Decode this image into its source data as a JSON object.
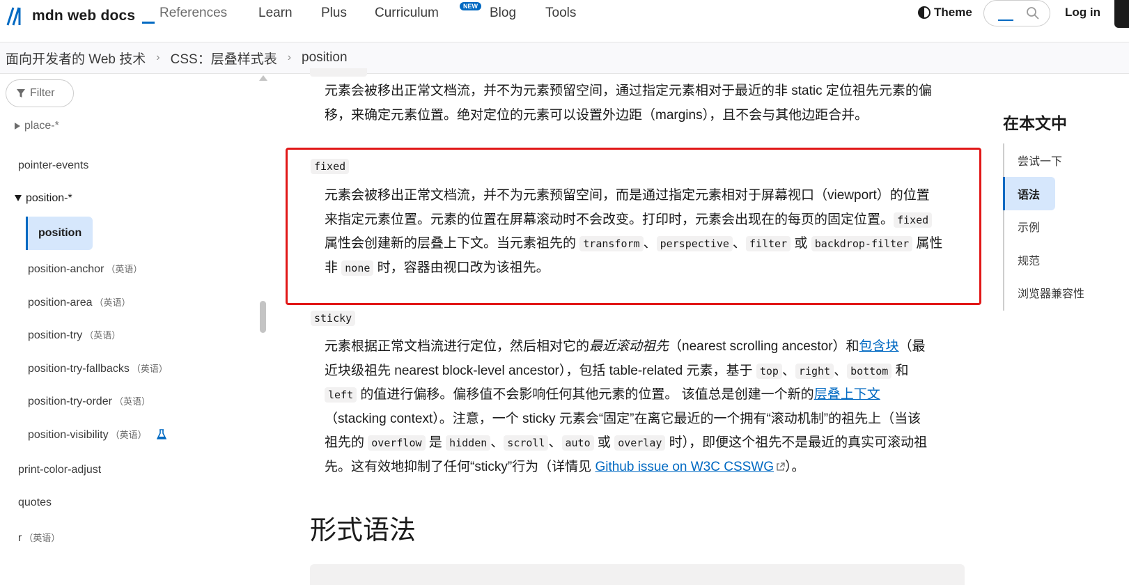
{
  "nav": {
    "logo_text": "mdn web docs",
    "items": [
      "References",
      "Learn",
      "Plus",
      "Curriculum",
      "Blog",
      "Tools"
    ],
    "new_badge": "NEW",
    "theme_label": "Theme",
    "login_label": "Log in"
  },
  "breadcrumb": [
    "面向开发者的 Web 技术",
    "CSS：层叠样式表",
    "position"
  ],
  "sidebar": {
    "filter_placeholder": "Filter",
    "items": {
      "place": "place-*",
      "pointer_events": "pointer-events",
      "position_group": "position-*",
      "position": "position",
      "position_anchor": "position-anchor",
      "position_area": "position-area",
      "position_try": "position-try",
      "position_try_fallbacks": "position-try-fallbacks",
      "position_try_order": "position-try-order",
      "position_visibility": "position-visibility",
      "print_color_adjust": "print-color-adjust",
      "quotes": "quotes",
      "r": "r"
    },
    "english_tag": "（英语）"
  },
  "content": {
    "absolute_text_1": "元素会被移出正常文档流，并不为元素预留空间，通过指定元素相对于最近的非 static 定位祖先元素的偏",
    "absolute_text_2": "移，来确定元素位置。绝对定位的元素可以设置外边距（margins），且不会与其他边距合并。",
    "fixed_term": "fixed",
    "fixed_text_1": "元素会被移出正常文档流，并不为元素预留空间，而是通过指定元素相对于屏幕视口（viewport）的位置",
    "fixed_text_2a": "来指定元素位置。元素的位置在屏幕滚动时不会改变。打印时，元素会出现在的每页的固定位置。",
    "fixed_code_fixed": "fixed",
    "fixed_text_3a": "属性会创建新的层叠上下文。当元素祖先的 ",
    "code_transform": "transform",
    "code_perspective": "perspective",
    "code_filter": "filter",
    "text_or": " 或 ",
    "code_backdrop": "backdrop-filter",
    "text_attr": " 属性",
    "fixed_text_4a": "非 ",
    "code_none": "none",
    "fixed_text_4b": " 时，容器由视口改为该祖先。",
    "sticky_term": "sticky",
    "sticky_1a": "元素根据正常文档流进行定位，然后相对它的",
    "sticky_1_em": "最近滚动祖先",
    "sticky_1b": "（nearest scrolling ancestor）和",
    "sticky_1_link": "包含块",
    "sticky_1c": "（最",
    "sticky_2a": "近块级祖先 nearest block-level ancestor），包括 table-related 元素，基于 ",
    "code_top": "top",
    "code_right": "right",
    "code_bottom": "bottom",
    "text_and": " 和",
    "code_left": "left",
    "sticky_3a": " 的值进行偏移。偏移值不会影响任何其他元素的位置。 该值总是创建一个新的",
    "sticky_3_link": "层叠上下文",
    "sticky_4": "（stacking context）。注意，一个 sticky 元素会“固定”在离它最近的一个拥有“滚动机制”的祖先上（当该",
    "sticky_5a": "祖先的 ",
    "code_overflow": "overflow",
    "text_is": " 是 ",
    "code_hidden": "hidden",
    "code_scroll": "scroll",
    "code_auto": "auto",
    "code_overlay": "overlay",
    "sticky_5b": " 时），即便这个祖先不是最近的真实可滚动祖",
    "sticky_6a": "先。这有效地抑制了任何“sticky”行为（详情见 ",
    "sticky_6_link": "Github issue on W3C CSSWG",
    "sticky_6b": "）。",
    "sep": "、",
    "h2_syntax": "形式语法"
  },
  "toc": {
    "title": "在本文中",
    "items": [
      "尝试一下",
      "语法",
      "示例",
      "规范",
      "浏览器兼容性"
    ],
    "active_index": 1
  },
  "colors": {
    "accent": "#0069c2",
    "highlight_border": "#e11818",
    "active_bg": "#d6e7fc"
  }
}
